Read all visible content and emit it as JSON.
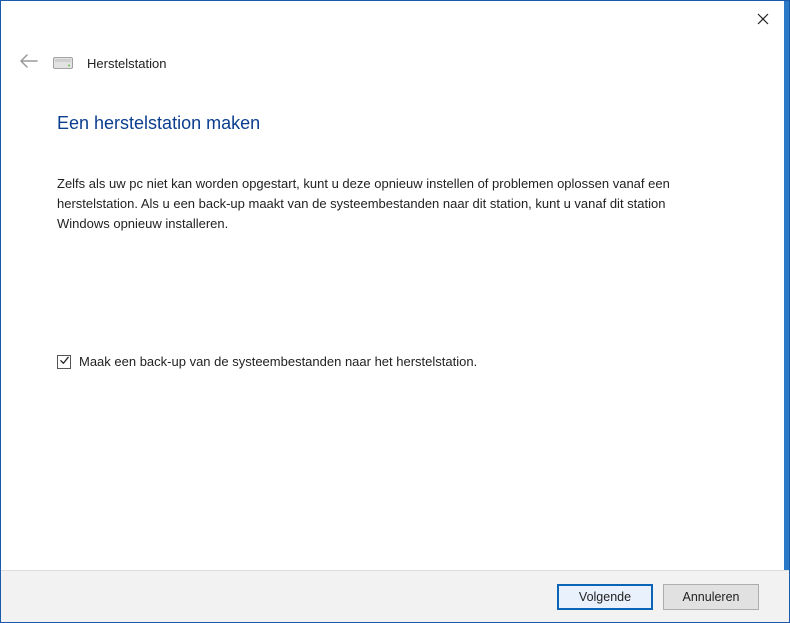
{
  "header": {
    "app_name": "Herstelstation"
  },
  "main": {
    "title": "Een herstelstation maken",
    "description": "Zelfs als uw pc niet kan worden opgestart, kunt u deze opnieuw instellen of problemen oplossen vanaf een herstelstation. Als u een back-up maakt van de systeembestanden naar dit station, kunt u vanaf dit station Windows opnieuw installeren."
  },
  "checkbox": {
    "label": "Maak een back-up van de systeembestanden naar het herstelstation.",
    "checked": true
  },
  "footer": {
    "next_label": "Volgende",
    "cancel_label": "Annuleren"
  }
}
